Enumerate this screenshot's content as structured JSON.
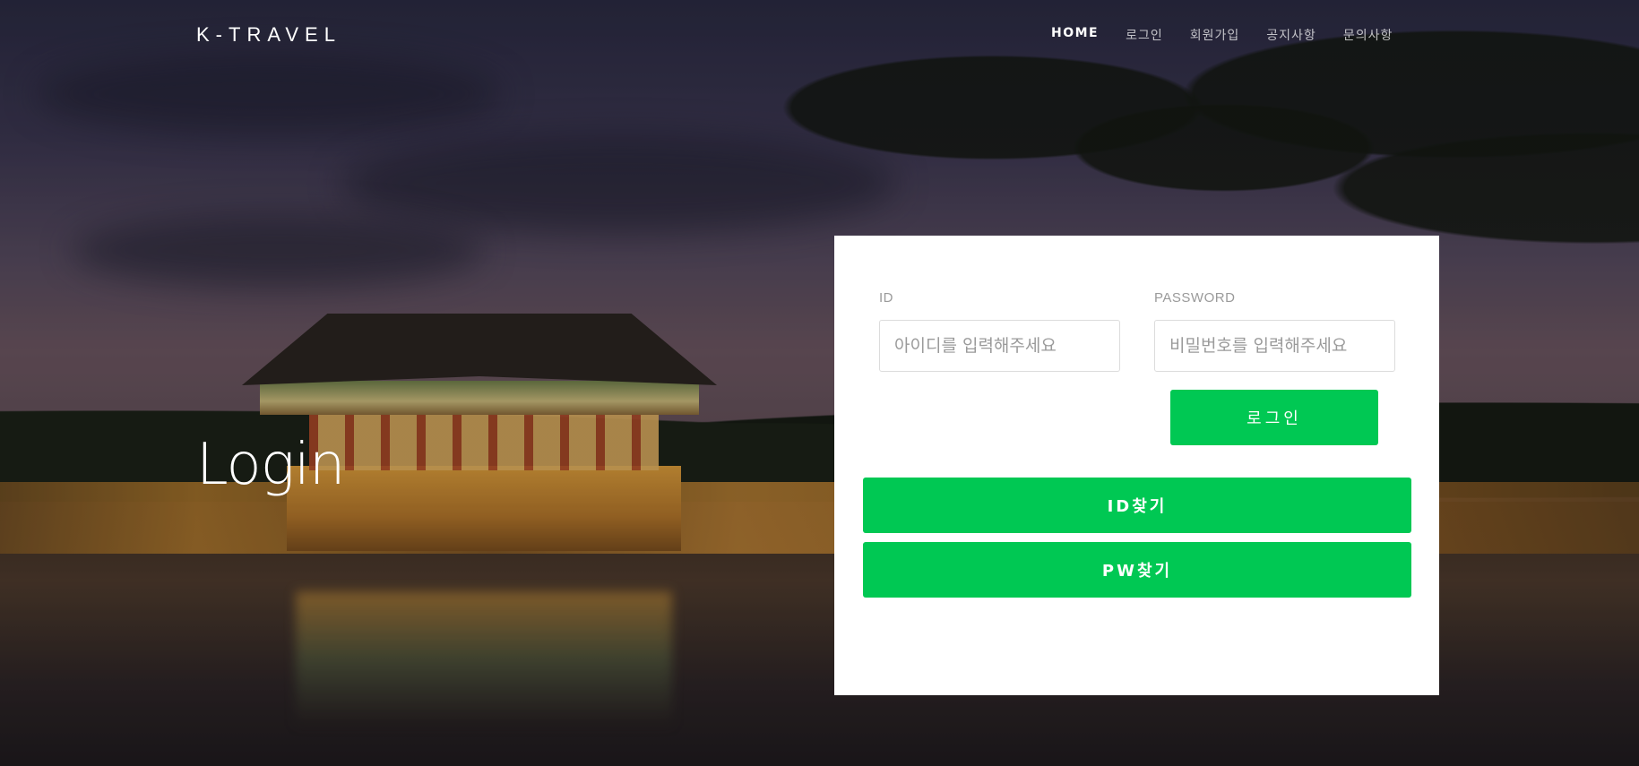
{
  "header": {
    "logo": "K-TRAVEL",
    "nav": [
      {
        "label": "HOME",
        "active": true
      },
      {
        "label": "로그인",
        "active": false
      },
      {
        "label": "회원가입",
        "active": false
      },
      {
        "label": "공지사항",
        "active": false
      },
      {
        "label": "문의사항",
        "active": false
      }
    ]
  },
  "hero": {
    "title": "Login"
  },
  "login_form": {
    "id_label": "ID",
    "id_placeholder": "아이디를 입력해주세요",
    "password_label": "PASSWORD",
    "password_placeholder": "비밀번호를 입력해주세요",
    "login_button": "로그인",
    "find_id_button": "ID찾기",
    "find_pw_button": "PW찾기"
  },
  "colors": {
    "accent": "#00c853",
    "card_background": "#ffffff"
  }
}
